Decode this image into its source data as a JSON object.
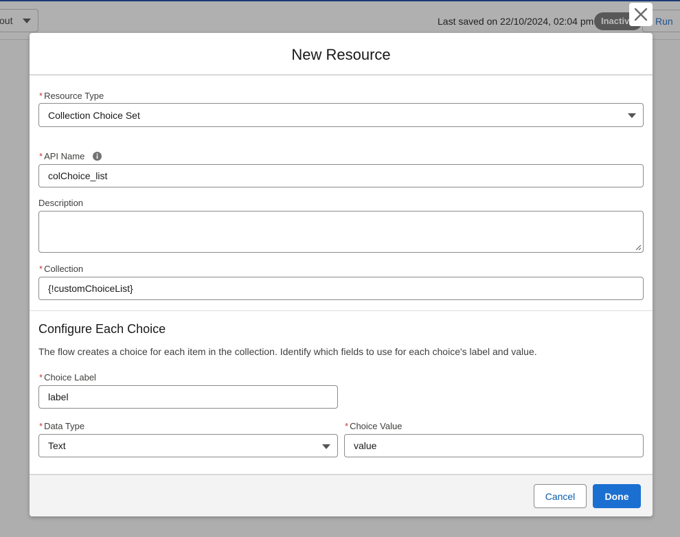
{
  "topbar": {
    "layout_label": "out",
    "last_saved": "Last saved on 22/10/2024, 02:04 pm",
    "status_badge": "Inactive",
    "run_label": "Run"
  },
  "modal": {
    "title": "New Resource",
    "resource_type": {
      "label": "Resource Type",
      "value": "Collection Choice Set"
    },
    "api_name": {
      "label": "API Name",
      "value": "colChoice_list"
    },
    "description": {
      "label": "Description",
      "value": ""
    },
    "collection": {
      "label": "Collection",
      "value": "{!customChoiceList}"
    },
    "configure": {
      "title": "Configure Each Choice",
      "description": "The flow creates a choice for each item in the collection. Identify which fields to use for each choice's label and value."
    },
    "choice_label": {
      "label": "Choice Label",
      "value": "label"
    },
    "data_type": {
      "label": "Data Type",
      "value": "Text"
    },
    "choice_value": {
      "label": "Choice Value",
      "value": "value"
    },
    "footer": {
      "cancel_label": "Cancel",
      "done_label": "Done"
    }
  },
  "colors": {
    "accent": "#1b6fd1",
    "required": "#c23934",
    "link": "#0b5cab"
  }
}
